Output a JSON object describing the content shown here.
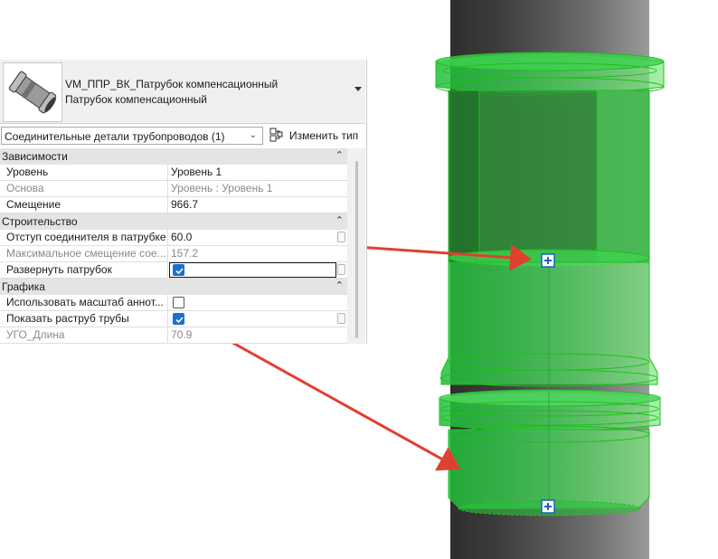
{
  "viewport": {
    "description_colors": {
      "pipe": "#4a4a4a",
      "fitting_fill": "#4cd964",
      "fitting_edge": "#18c518",
      "arrow": "#e04030",
      "grip": "#1565c0"
    }
  },
  "type_selector": {
    "name_line1": "VM_ППР_ВК_Патрубок компенсационный",
    "name_line2": "Патрубок компенсационный",
    "category_select": "Соединительные детали трубопроводов (1)",
    "edit_type_label": "Изменить тип"
  },
  "groups": [
    {
      "label": "Зависимости",
      "rows": [
        {
          "name": "Уровень",
          "value": "Уровень 1",
          "greyed": false
        },
        {
          "name": "Основа",
          "value": "Уровень : Уровень 1",
          "greyed": true
        },
        {
          "name": "Смещение",
          "value": "966.7",
          "greyed": false
        }
      ]
    },
    {
      "label": "Строительство",
      "rows": [
        {
          "name": "Отступ соединителя в патрубке",
          "value": "60.0",
          "greyed": false
        },
        {
          "name": "Максимальное смещение сое...",
          "value": "157.2",
          "greyed": true
        },
        {
          "name": "Развернуть патрубок",
          "checked": true,
          "greyed": false
        }
      ]
    },
    {
      "label": "Графика",
      "rows": [
        {
          "name": "Использовать масштаб аннот...",
          "checked": false,
          "greyed": false
        },
        {
          "name": "Показать раструб трубы",
          "checked": true,
          "greyed": false
        },
        {
          "name": "УГО_Длина",
          "value": "70.9",
          "greyed": true
        }
      ]
    }
  ]
}
